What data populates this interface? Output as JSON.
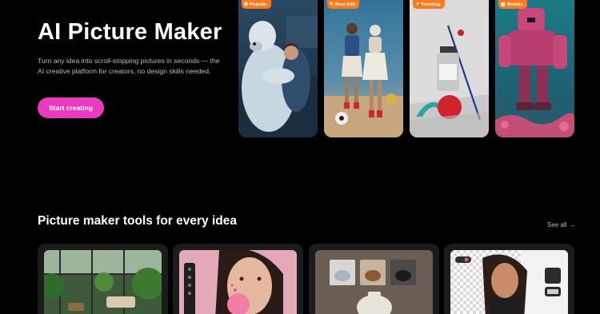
{
  "hero": {
    "title": "AI Picture Maker",
    "subtitle": "Turn any idea into scroll-stopping pictures in seconds — the AI creative platform for creators, no design skills needed.",
    "cta_label": "Start creating"
  },
  "showcase": [
    {
      "badge": "Popular",
      "icon": "sparkle-icon",
      "glyph": "❂",
      "image": "polar-bear-hug-photo"
    },
    {
      "badge": "Best Edit",
      "icon": "magic-edit-icon",
      "glyph": "✎",
      "image": "two-women-fashion-photo"
    },
    {
      "badge": "Trending",
      "icon": "trending-icon",
      "glyph": "↗",
      "image": "perfume-still-life-photo"
    },
    {
      "badge": "Models",
      "icon": "cube-icon",
      "glyph": "▣",
      "image": "pink-robot-underwater-art"
    }
  ],
  "tools_section": {
    "title": "Picture maker tools for every idea",
    "see_all_label": "See all",
    "see_all_icon": "arrow-right-icon"
  },
  "tools": [
    {
      "image": "greenhouse-interior-photo"
    },
    {
      "image": "bubble-gum-portrait-photo"
    },
    {
      "image": "teapot-variations-photo"
    },
    {
      "image": "background-remover-portrait-photo"
    }
  ],
  "colors": {
    "background": "#000000",
    "accent": "#e93bbf",
    "badge": "#ff7a1f",
    "card": "#1c1c1c"
  }
}
